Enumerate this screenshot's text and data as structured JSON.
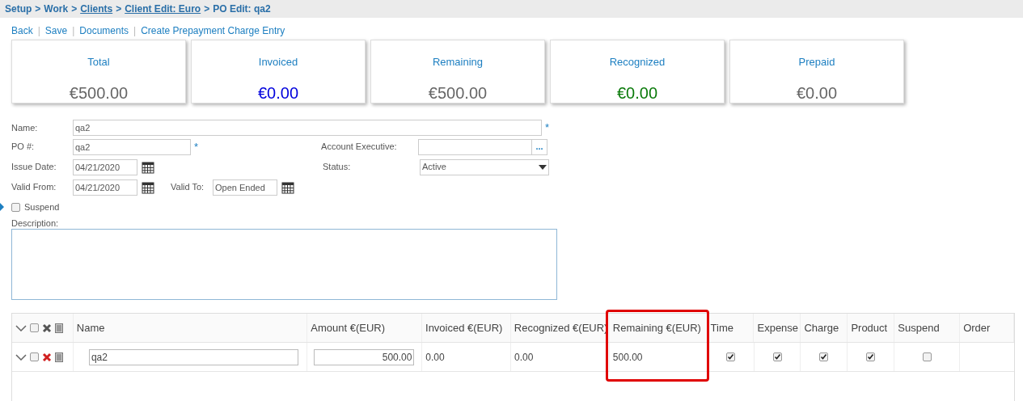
{
  "breadcrumb": [
    {
      "label": "Setup",
      "link": false
    },
    {
      "separator": ">",
      "label": "Work",
      "link": false
    },
    {
      "separator": ">",
      "label": "Clients",
      "link": true
    },
    {
      "separator": ">",
      "label": "Client Edit: Euro",
      "link": true
    },
    {
      "separator": ">",
      "label": "PO Edit: qa2",
      "link": false
    }
  ],
  "actions": [
    {
      "label": "Back"
    },
    {
      "separator": "|",
      "label": "Save"
    },
    {
      "separator": "|",
      "label": "Documents"
    },
    {
      "separator": "|",
      "label": "Create Prepayment Charge Entry"
    }
  ],
  "cards": [
    {
      "label": "Total",
      "value": "€500.00",
      "color": "#666666"
    },
    {
      "label": "Invoiced",
      "value": "€0.00",
      "color": "#0000dd"
    },
    {
      "label": "Remaining",
      "value": "€500.00",
      "color": "#666666"
    },
    {
      "label": "Recognized",
      "value": "€0.00",
      "color": "#0a7a0a"
    },
    {
      "label": "Prepaid",
      "value": "€0.00",
      "color": "#666666"
    }
  ],
  "form": {
    "name": {
      "label": "Name:",
      "value": "qa2",
      "required_mark": "*"
    },
    "po": {
      "label": "PO #:",
      "value": "qa2",
      "required_mark": "*"
    },
    "account_executive": {
      "label": "Account Executive:",
      "button": "..."
    },
    "issue_date": {
      "label": "Issue Date:",
      "value": "04/21/2020"
    },
    "status": {
      "label": "Status:",
      "value": "Active"
    },
    "valid_from": {
      "label": "Valid From:",
      "value": "04/21/2020"
    },
    "valid_to": {
      "label": "Valid To:",
      "placeholder": "Open Ended"
    },
    "suspend": {
      "label": "Suspend",
      "checked": false
    },
    "description": {
      "label": "Description:"
    }
  },
  "table": {
    "columns": [
      "Name",
      "Amount €(EUR)",
      "Invoiced €(EUR)",
      "Recognized €(EUR)",
      "Remaining €(EUR)",
      "Time",
      "Expense",
      "Charge",
      "Product",
      "Suspend",
      "Order"
    ],
    "all_selected": false,
    "remaining_highlighted": true,
    "rows": [
      {
        "selected": false,
        "name": "qa2",
        "amount": "500.00",
        "invoiced": "0.00",
        "recognized": "0.00",
        "remaining": "500.00",
        "time": true,
        "expense": true,
        "charge": true,
        "product": true,
        "suspend": false
      }
    ]
  }
}
